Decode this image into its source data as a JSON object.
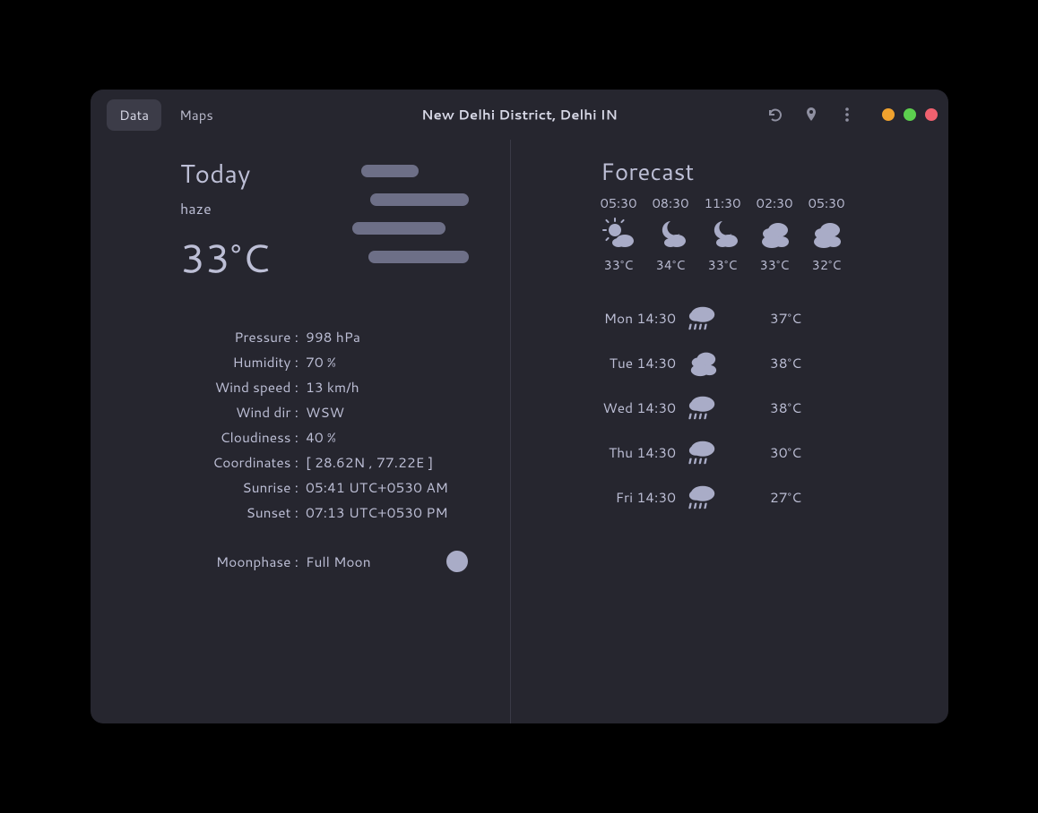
{
  "header": {
    "tabs": {
      "data": "Data",
      "maps": "Maps"
    },
    "location": "New Delhi District, Delhi IN"
  },
  "today": {
    "title": "Today",
    "condition": "haze",
    "temp": "33°C",
    "details": {
      "pressure_label": "Pressure :",
      "pressure": "998 hPa",
      "humidity_label": "Humidity :",
      "humidity": "70 %",
      "windspeed_label": "Wind speed :",
      "windspeed": "13 km/h",
      "winddir_label": "Wind dir :",
      "winddir": "WSW",
      "cloudiness_label": "Cloudiness :",
      "cloudiness": "40 %",
      "coords_label": "Coordinates :",
      "coords": "[ 28.62N , 77.22E ]",
      "sunrise_label": "Sunrise :",
      "sunrise": "05:41 UTC+0530 AM",
      "sunset_label": "Sunset :",
      "sunset": "07:13 UTC+0530 PM",
      "moonphase_label": "Moonphase :",
      "moonphase": "Full Moon"
    }
  },
  "forecast": {
    "title": "Forecast",
    "hourly": [
      {
        "time": "05:30",
        "temp": "33°C",
        "icon": "sun-cloud"
      },
      {
        "time": "08:30",
        "temp": "34°C",
        "icon": "moon-cloud"
      },
      {
        "time": "11:30",
        "temp": "33°C",
        "icon": "moon-cloud"
      },
      {
        "time": "02:30",
        "temp": "33°C",
        "icon": "clouds"
      },
      {
        "time": "05:30",
        "temp": "32°C",
        "icon": "clouds"
      }
    ],
    "daily": [
      {
        "day": "Mon 14:30",
        "temp": "37°C",
        "icon": "rain"
      },
      {
        "day": "Tue 14:30",
        "temp": "38°C",
        "icon": "clouds"
      },
      {
        "day": "Wed 14:30",
        "temp": "38°C",
        "icon": "rain"
      },
      {
        "day": "Thu 14:30",
        "temp": "30°C",
        "icon": "rain"
      },
      {
        "day": "Fri 14:30",
        "temp": "27°C",
        "icon": "rain"
      }
    ]
  }
}
